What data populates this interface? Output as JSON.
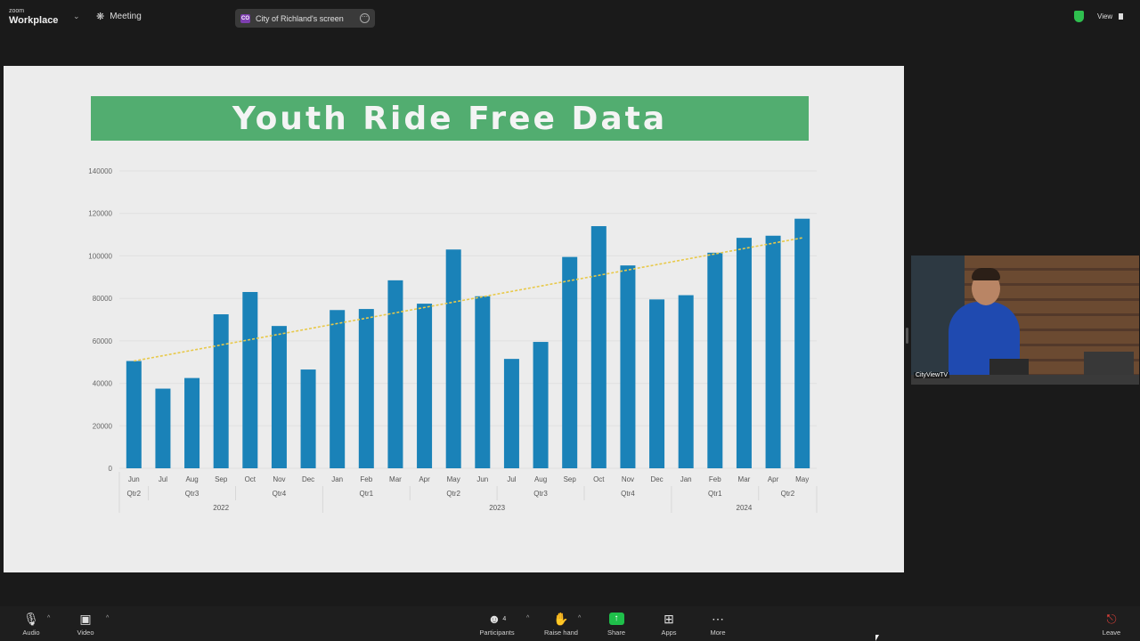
{
  "topbar": {
    "brand_small": "zoom",
    "brand_big": "Workplace",
    "meeting_label": "Meeting",
    "share_initials": "CO",
    "share_label": "City of Richland's screen",
    "view_label": "View",
    "shield_color": "#2fbf4f"
  },
  "slide": {
    "title": "Youth Ride Free Data",
    "banner_color": "#52ad70"
  },
  "chart_data": {
    "type": "bar",
    "bar_color": "#1a82b8",
    "trendline_color": "#e8c94a",
    "ylim": [
      0,
      140000
    ],
    "yticks": [
      0,
      20000,
      40000,
      60000,
      80000,
      100000,
      120000,
      140000
    ],
    "categories": [
      "Jun",
      "Jul",
      "Aug",
      "Sep",
      "Oct",
      "Nov",
      "Dec",
      "Jan",
      "Feb",
      "Mar",
      "Apr",
      "May",
      "Jun",
      "Jul",
      "Aug",
      "Sep",
      "Oct",
      "Nov",
      "Dec",
      "Jan",
      "Feb",
      "Mar",
      "Apr",
      "May"
    ],
    "values": [
      50500,
      37500,
      42500,
      72500,
      83000,
      67000,
      46500,
      74500,
      75000,
      88500,
      77500,
      103000,
      81000,
      51500,
      59500,
      99500,
      114000,
      95500,
      79500,
      81500,
      101500,
      108500,
      109500,
      117500
    ],
    "trendline": {
      "start": 50500,
      "end": 108500
    },
    "quarters": [
      {
        "label": "Qtr2",
        "start": 0,
        "end": 0
      },
      {
        "label": "Qtr3",
        "start": 1,
        "end": 3
      },
      {
        "label": "Qtr4",
        "start": 4,
        "end": 6
      },
      {
        "label": "Qtr1",
        "start": 7,
        "end": 9
      },
      {
        "label": "Qtr2",
        "start": 10,
        "end": 12
      },
      {
        "label": "Qtr3",
        "start": 13,
        "end": 15
      },
      {
        "label": "Qtr4",
        "start": 16,
        "end": 18
      },
      {
        "label": "Qtr1",
        "start": 19,
        "end": 21
      },
      {
        "label": "Qtr2",
        "start": 22,
        "end": 23
      }
    ],
    "years": [
      {
        "label": "2022",
        "start": 0,
        "end": 6
      },
      {
        "label": "2023",
        "start": 7,
        "end": 18
      },
      {
        "label": "2024",
        "start": 19,
        "end": 23
      }
    ]
  },
  "speaker": {
    "name": "CityViewTV"
  },
  "toolbar": {
    "audio": "Audio",
    "video": "Video",
    "participants": "Participants",
    "participants_count": "4",
    "raise_hand": "Raise hand",
    "share": "Share",
    "apps": "Apps",
    "more": "More",
    "leave": "Leave",
    "share_color": "#1fbf4a",
    "leave_color": "#e0413a"
  }
}
